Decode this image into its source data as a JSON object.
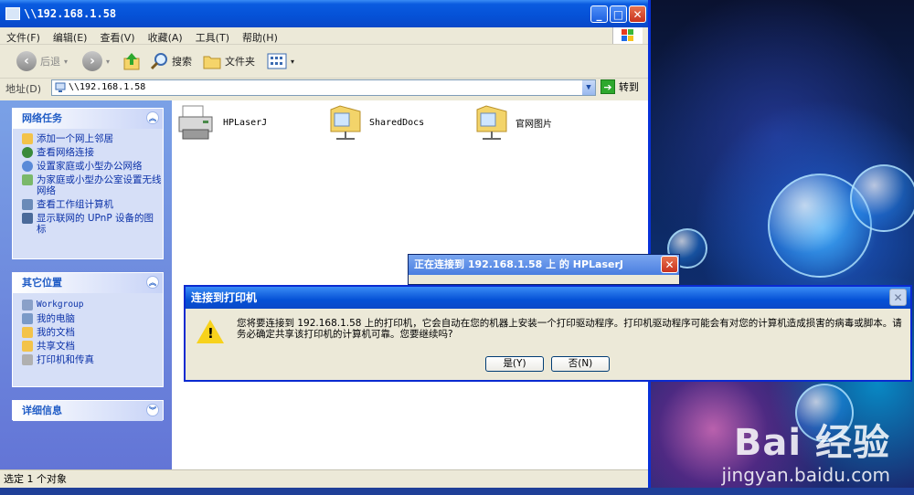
{
  "explorer": {
    "title": "\\\\192.168.1.58",
    "menu": [
      "文件(F)",
      "编辑(E)",
      "查看(V)",
      "收藏(A)",
      "工具(T)",
      "帮助(H)"
    ],
    "toolbar": {
      "back": "后退",
      "search": "搜索",
      "folders": "文件夹"
    },
    "address_label": "地址(D)",
    "address_value": "\\\\192.168.1.58",
    "go_label": "转到",
    "status": "选定 1 个对象"
  },
  "left_panels": {
    "network_tasks": {
      "title": "网络任务",
      "links": [
        "添加一个网上邻居",
        "查看网络连接",
        "设置家庭或小型办公网络",
        "为家庭或小型办公室设置无线网络",
        "查看工作组计算机",
        "显示联网的 UPnP 设备的图标"
      ]
    },
    "other_places": {
      "title": "其它位置",
      "links": [
        "Workgroup",
        "我的电脑",
        "我的文档",
        "共享文档",
        "打印机和传真"
      ]
    },
    "details": {
      "title": "详细信息"
    }
  },
  "items": [
    "HPLaserJ",
    "SharedDocs",
    "官网图片"
  ],
  "connecting_dialog": {
    "title": "正在连接到 192.168.1.58 上 的 HPLaserJ"
  },
  "dialog": {
    "title": "连接到打印机",
    "message": "您将要连接到 192.168.1.58 上的打印机，它会自动在您的机器上安装一个打印驱动程序。打印机驱动程序可能会有对您的计算机造成损害的病毒或脚本。请务必确定共享该打印机的计算机可靠。您要继续吗?",
    "yes": "是(Y)",
    "no": "否(N)"
  },
  "watermark": {
    "main": "Bai 经验",
    "sub": "jingyan.baidu.com"
  }
}
